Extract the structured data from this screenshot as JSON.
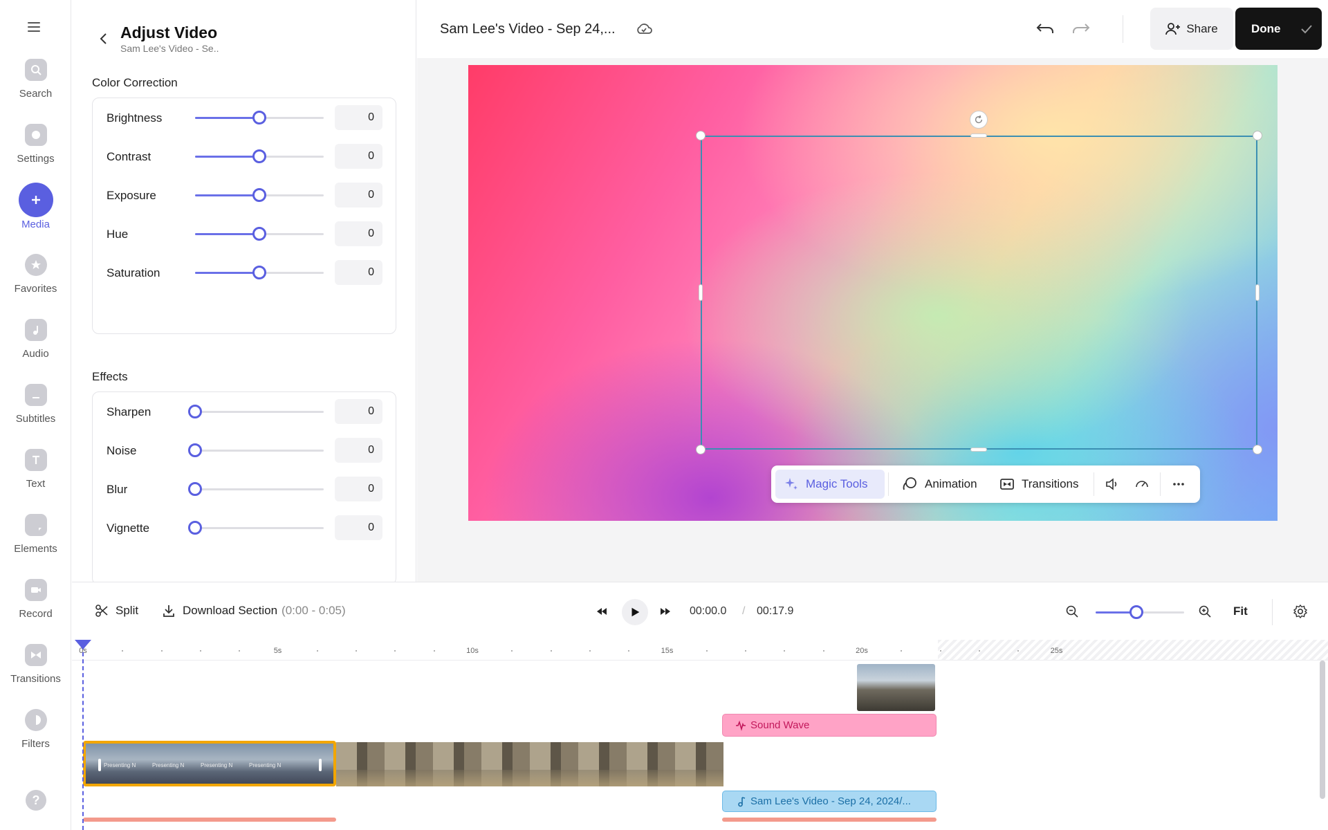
{
  "rail": {
    "items": [
      {
        "label": "Search",
        "icon": "search-icon"
      },
      {
        "label": "Settings",
        "icon": "settings-icon"
      },
      {
        "label": "Media",
        "icon": "plus-icon",
        "active": true
      },
      {
        "label": "Favorites",
        "icon": "star-icon"
      },
      {
        "label": "Audio",
        "icon": "music-note-icon"
      },
      {
        "label": "Subtitles",
        "icon": "subtitles-icon"
      },
      {
        "label": "Text",
        "icon": "text-icon"
      },
      {
        "label": "Elements",
        "icon": "elements-icon"
      },
      {
        "label": "Record",
        "icon": "camera-icon"
      },
      {
        "label": "Transitions",
        "icon": "transitions-icon"
      },
      {
        "label": "Filters",
        "icon": "filters-icon"
      }
    ],
    "help_label": "?"
  },
  "panel": {
    "title": "Adjust Video",
    "subtitle": "Sam Lee's Video - Se..",
    "color_section": "Color Correction",
    "color_sliders": [
      {
        "label": "Brightness",
        "value": "0",
        "position": 0.5
      },
      {
        "label": "Contrast",
        "value": "0",
        "position": 0.5
      },
      {
        "label": "Exposure",
        "value": "0",
        "position": 0.5
      },
      {
        "label": "Hue",
        "value": "0",
        "position": 0.5
      },
      {
        "label": "Saturation",
        "value": "0",
        "position": 0.5
      }
    ],
    "effects_section": "Effects",
    "effect_sliders": [
      {
        "label": "Sharpen",
        "value": "0",
        "position": 0
      },
      {
        "label": "Noise",
        "value": "0",
        "position": 0
      },
      {
        "label": "Blur",
        "value": "0",
        "position": 0
      },
      {
        "label": "Vignette",
        "value": "0",
        "position": 0
      }
    ]
  },
  "topbar": {
    "title": "Sam Lee's Video - Sep 24,...",
    "share_label": "Share",
    "done_label": "Done"
  },
  "toolbar": {
    "magic_label": "Magic Tools",
    "animation_label": "Animation",
    "transitions_label": "Transitions"
  },
  "controls": {
    "split_label": "Split",
    "download_label": "Download Section",
    "download_range": "(0:00 - 0:05)",
    "current_time": "00:00.0",
    "time_separator": "/",
    "total_time": "00:17.9",
    "fit_label": "Fit",
    "zoom_level": 0.46
  },
  "timeline": {
    "ticks": [
      "0s",
      "5s",
      "10s",
      "15s",
      "20s",
      "25s"
    ],
    "sound_clip_label": "Sound Wave",
    "audio_clip_label": "Sam Lee's Video - Sep 24, 2024/...",
    "clip_caption": "Presenting N"
  },
  "colors": {
    "accent": "#5a5fe0",
    "selected_clip_border": "#f2a600",
    "sound_clip": "#ffa3c6",
    "audio_clip": "#a9d8f3"
  }
}
